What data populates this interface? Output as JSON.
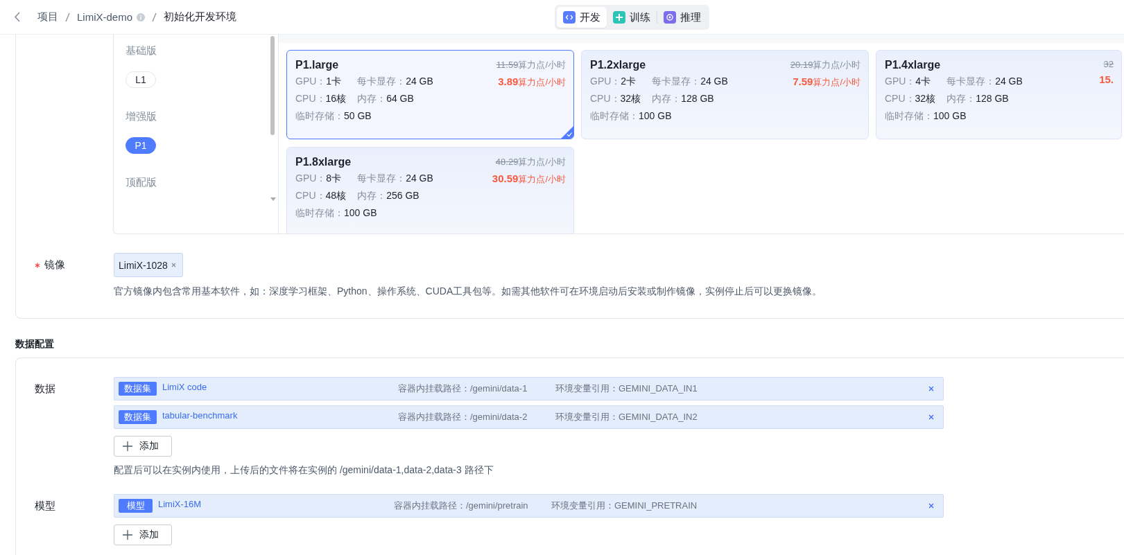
{
  "breadcrumb": [
    {
      "label": "项目"
    },
    {
      "label": "LimiX-demo",
      "info": true
    },
    {
      "label": "初始化开发环境"
    }
  ],
  "mode_tabs": [
    {
      "label": "开发",
      "kind": "dev",
      "selected": true
    },
    {
      "label": "训练",
      "kind": "train",
      "selected": false
    },
    {
      "label": "推理",
      "kind": "infer",
      "selected": false
    }
  ],
  "resource": {
    "tiers": [
      {
        "name": "基础版",
        "options": [
          {
            "label": "L1",
            "selected": false
          }
        ]
      },
      {
        "name": "增强版",
        "options": [
          {
            "label": "P1",
            "selected": true
          }
        ]
      },
      {
        "name": "顶配版"
      }
    ],
    "plans": [
      {
        "name": "P1.large",
        "list_price": "11.59",
        "list_unit": "算力点/小时",
        "price": "3.89",
        "price_unit": "算力点/小时",
        "selected": true,
        "specs": [
          {
            "label": "GPU：",
            "value": "1卡"
          },
          {
            "label": "每卡显存：",
            "value": "24 GB"
          },
          {
            "label": "CPU：",
            "value": "16核"
          },
          {
            "label": "内存：",
            "value": "64 GB"
          },
          {
            "label": "临时存储：",
            "value": "50 GB"
          }
        ]
      },
      {
        "name": "P1.2xlarge",
        "list_price": "20.19",
        "list_unit": "算力点/小时",
        "price": "7.59",
        "price_unit": "算力点/小时",
        "selected": false,
        "specs": [
          {
            "label": "GPU：",
            "value": "2卡"
          },
          {
            "label": "每卡显存：",
            "value": "24 GB"
          },
          {
            "label": "CPU：",
            "value": "32核"
          },
          {
            "label": "内存：",
            "value": "128 GB"
          },
          {
            "label": "临时存储：",
            "value": "100 GB"
          }
        ]
      },
      {
        "name": "P1.4xlarge",
        "list_price": "32",
        "price": "15.",
        "selected": false,
        "specs": [
          {
            "label": "GPU：",
            "value": "4卡"
          },
          {
            "label": "每卡显存：",
            "value": "24 GB"
          },
          {
            "label": "CPU：",
            "value": "32核"
          },
          {
            "label": "内存：",
            "value": "128 GB"
          },
          {
            "label": "临时存储：",
            "value": "100 GB"
          }
        ]
      },
      {
        "name": "P1.8xlarge",
        "list_price": "48.29",
        "list_unit": "算力点/小时",
        "price": "30.59",
        "price_unit": "算力点/小时",
        "selected": false,
        "specs": [
          {
            "label": "GPU：",
            "value": "8卡"
          },
          {
            "label": "每卡显存：",
            "value": "24 GB"
          },
          {
            "label": "CPU：",
            "value": "48核"
          },
          {
            "label": "内存：",
            "value": "256 GB"
          },
          {
            "label": "临时存储：",
            "value": "100 GB"
          }
        ]
      }
    ]
  },
  "image": {
    "label": "镜像",
    "required": true,
    "tags": [
      "LimiX-1028"
    ],
    "note": "官方镜像内包含常用基本软件，如：深度学习框架、Python、操作系统、CUDA工具包等。如需其他软件可在环境启动后安装或制作镜像，实例停止后可以更换镜像。"
  },
  "data_config": {
    "title": "数据配置",
    "groups": [
      {
        "label": "数据",
        "rows": [
          {
            "badge": "数据集",
            "name": "LimiX code",
            "path": "容器内挂载路径：/gemini/data-1",
            "env": "环境变量引用：GEMINI_DATA_IN1"
          },
          {
            "badge": "数据集",
            "name": "tabular-benchmark",
            "path": "容器内挂载路径：/gemini/data-2",
            "env": "环境变量引用：GEMINI_DATA_IN2"
          }
        ],
        "add": "添加",
        "note": "配置后可以在实例内使用，上传后的文件将在实例的 /gemini/data-1,data-2,data-3 路径下"
      },
      {
        "label": "模型",
        "rows": [
          {
            "badge": "模型",
            "name": "LimiX-16M",
            "path": "容器内挂载路径：/gemini/pretrain",
            "env": "环境变量引用：GEMINI_PRETRAIN"
          }
        ],
        "add": "添加"
      }
    ]
  }
}
